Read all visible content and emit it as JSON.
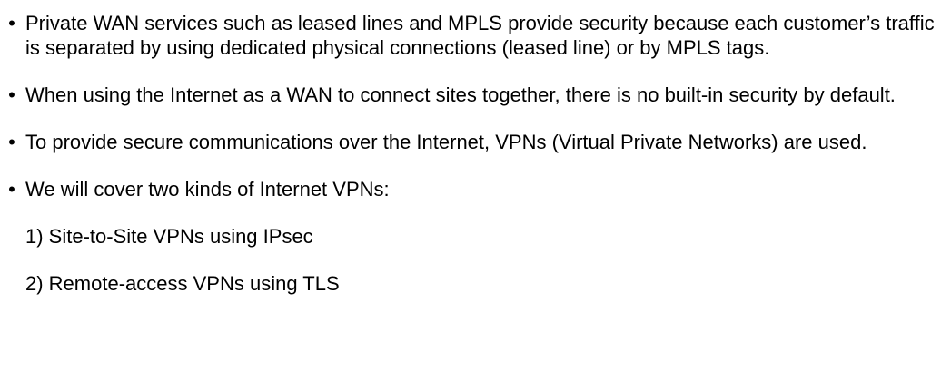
{
  "bullets": [
    {
      "symbol": "•",
      "text": "Private WAN services such as leased lines and MPLS provide security because each customer’s traffic is separated by using dedicated physical connections (leased line) or by MPLS tags."
    },
    {
      "symbol": "•",
      "text": "When using the Internet as a WAN to connect sites together, there is no built-in security by default."
    },
    {
      "symbol": "•",
      "text": "To provide secure communications over the Internet, VPNs (Virtual Private Networks) are used."
    },
    {
      "symbol": "•",
      "text": "We will cover two kinds of Internet VPNs:"
    }
  ],
  "numbered": [
    "1) Site-to-Site VPNs using IPsec",
    "2) Remote-access VPNs using TLS"
  ]
}
